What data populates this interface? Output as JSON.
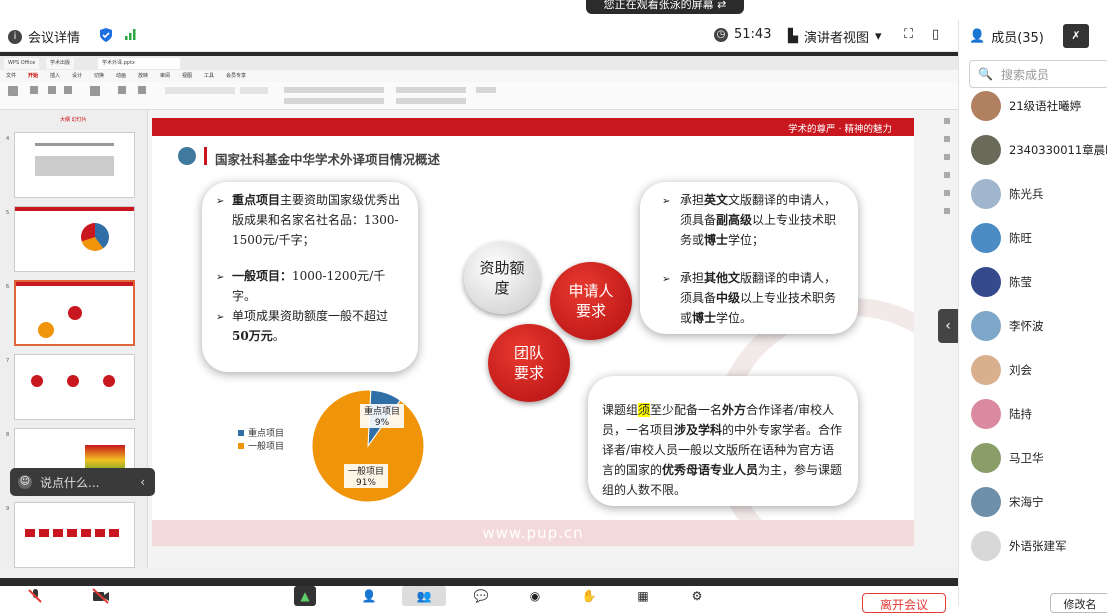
{
  "banner": {
    "text": "您正在观看张泳的屏幕"
  },
  "meeting_bar": {
    "details_label": "会议详情",
    "timer": "51:43",
    "view_label": "演讲者视图"
  },
  "panel": {
    "members_label": "成员(35)",
    "search_placeholder": "搜索成员",
    "members": [
      {
        "name": "21级语社曦婷",
        "color": "#b08060"
      },
      {
        "name": "2340330011章晨昕",
        "color": "#6a6a5a"
      },
      {
        "name": "陈光兵",
        "color": "#9fb6cc"
      },
      {
        "name": "陈旺",
        "color": "#4c8bc4"
      },
      {
        "name": "陈莹",
        "color": "#344a8c"
      },
      {
        "name": "李怀波",
        "color": "#7fa7c9"
      },
      {
        "name": "刘会",
        "color": "#d9b08e"
      },
      {
        "name": "陆持",
        "color": "#d98aa0"
      },
      {
        "name": "马卫华",
        "color": "#8a9e6a"
      },
      {
        "name": "宋海宁",
        "color": "#6d8faa"
      },
      {
        "name": "外语张建军",
        "color": "#d8d8d8"
      }
    ]
  },
  "app": {
    "tabs": [
      "WPS Office",
      "学术出版",
      "学术外译.pptx"
    ],
    "menu": [
      "文件",
      "开始",
      "插入",
      "设计",
      "切换",
      "动画",
      "放映",
      "审阅",
      "视图",
      "工具",
      "会员专享"
    ],
    "active_menu": "开始"
  },
  "slide": {
    "tagline": "学术的尊严 · 精神的魅力",
    "title": "国家社科基金中华学术外译项目情况概述",
    "left_card": [
      {
        "bold": "重点项目",
        "text": "主要资助国家级优秀出版成果和名家名社名品：1300-1500元/千字；"
      },
      {
        "bold": "一般项目：",
        "text": "1000-1200元/千字。"
      },
      {
        "bold": "",
        "text": "单项成果资助额度一般不超过",
        "bold_tail": "50万元",
        "tail": "。"
      }
    ],
    "bubble_funding": "资助额度",
    "bubble_applicant": "申请人要求",
    "bubble_team": "团队要求",
    "right_card": [
      {
        "p1": "承担",
        "b1": "英文",
        "p2": "文版翻译的申请人，须具备",
        "b2": "副高级",
        "p3": "以上专业技术职务或",
        "b3": "博士",
        "p4": "学位；"
      },
      {
        "p1": "承担",
        "b1": "其他文",
        "p2": "版翻译的申请人，须具备",
        "b2": "中级",
        "p3": "以上专业技术职务或",
        "b3": "博士",
        "p4": "学位。"
      }
    ],
    "team_text": {
      "a": "课题组",
      "hl": "须",
      "b": "至少配备一名",
      "b1": "外方",
      "c": "合作译者/审校人员，一名项目",
      "b2": "涉及学科",
      "d": "的中外专家学者。合作译者/审校人员一般以文版所在语种为官方语言的国家的",
      "b3": "优秀母语专业人员",
      "e": "为主，参与课题组的人数不限。"
    },
    "footer": "www.pup.cn"
  },
  "chart_data": {
    "type": "pie",
    "categories": [
      "重点项目",
      "一般项目"
    ],
    "values": [
      9,
      91
    ],
    "labels": [
      "重点项目\n9%",
      "一般项目\n91%"
    ],
    "colors": [
      "#2f6fa6",
      "#f0940a"
    ],
    "legend": "left"
  },
  "comment": {
    "placeholder": "说点什么..."
  },
  "bottom": {
    "leave_label": "离开会议",
    "edit_label": "修改名"
  }
}
